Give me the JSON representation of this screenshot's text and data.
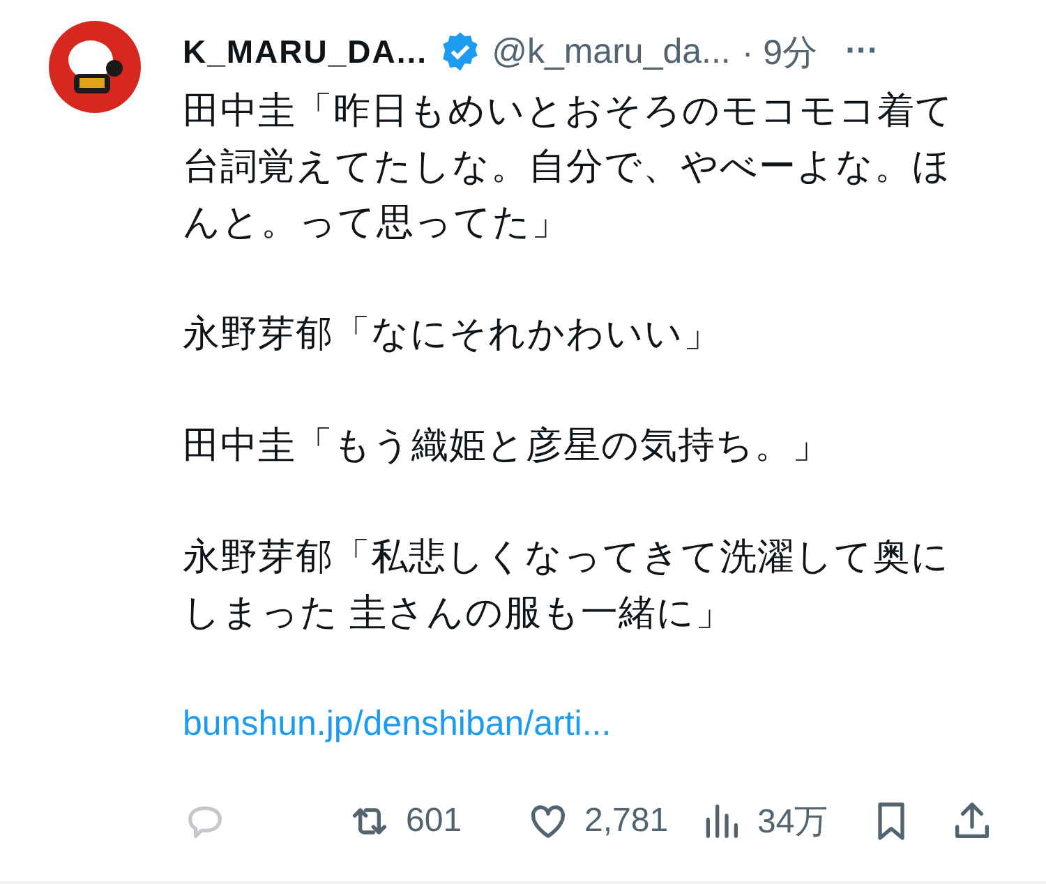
{
  "author": {
    "name": "K_MARU_DA...",
    "verified": true,
    "handle": "@k_maru_da...",
    "time": "· 9分",
    "more": "···"
  },
  "body": [
    "田中圭「昨日もめいとおそろのモコモコ着て台詞覚えてたしな。自分で、やべーよな。ほんと。って思ってた」",
    "永野芽郁「なにそれかわいい」",
    "田中圭「もう織姫と彦星の気持ち。」",
    "永野芽郁「私悲しくなってきて洗濯して奥にしまった 圭さんの服も一緒に」"
  ],
  "link": "bunshun.jp/denshiban/arti...",
  "actions": [
    {
      "kind": "reply"
    },
    {
      "kind": "retweet",
      "count": "601"
    },
    {
      "kind": "like",
      "count": "2,781"
    },
    {
      "kind": "views",
      "count": "34万"
    },
    {
      "kind": "bookmark"
    },
    {
      "kind": "share"
    }
  ]
}
